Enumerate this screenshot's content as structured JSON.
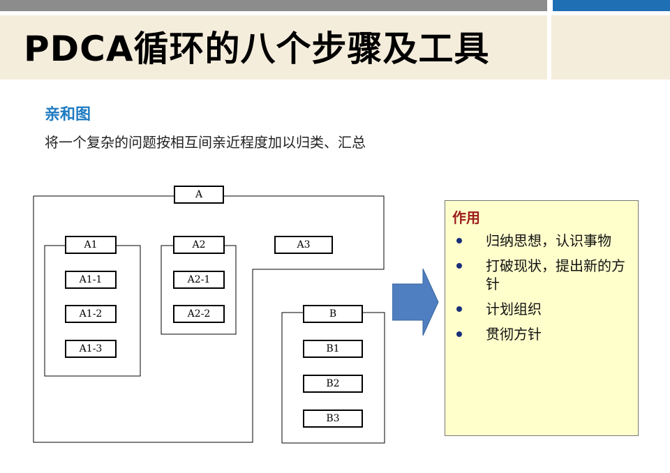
{
  "slide": {
    "title": "PDCA循环的八个步骤及工具",
    "subtitle": "亲和图",
    "description": "将一个复杂的问题按相互间亲近程度加以归类、汇总"
  },
  "diagram": {
    "top": "A",
    "group_a1": {
      "label": "A1",
      "children": [
        "A1-1",
        "A1-2",
        "A1-3"
      ]
    },
    "group_a2": {
      "label": "A2",
      "children": [
        "A2-1",
        "A2-2"
      ]
    },
    "group_a3": {
      "label": "A3"
    },
    "group_b": {
      "label": "B",
      "children": [
        "B1",
        "B2",
        "B3"
      ]
    }
  },
  "effect": {
    "title": "作用",
    "items": [
      "归纳思想，认识事物",
      "打破现状，提出新的方针",
      "计划组织",
      "贯彻方针"
    ]
  },
  "colors": {
    "subtitle": "#1f7bc1",
    "effect_title": "#9b1b1b",
    "effect_bg": "#ffffcc",
    "arrow": "#4f7fc0",
    "title_band": "#f5eddc"
  }
}
